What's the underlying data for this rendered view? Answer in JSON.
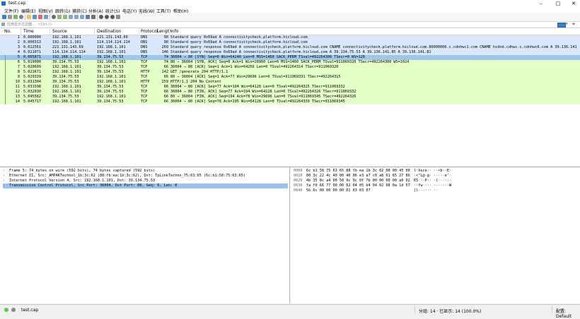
{
  "window": {
    "title": "test.cap"
  },
  "menu": [
    "文件(F)",
    "编辑(E)",
    "视图(V)",
    "跳转(G)",
    "捕获(C)",
    "分析(A)",
    "统计(S)",
    "电话(Y)",
    "无线(W)",
    "工具(T)",
    "帮助(H)"
  ],
  "filter": {
    "placeholder": "应用显示过滤器 … <Ctrl-/>"
  },
  "columns": [
    "No.",
    "Time",
    "Source",
    "Destination",
    "Protocol",
    "Length",
    "Info"
  ],
  "packets": [
    {
      "no": "1",
      "time": "0.000000",
      "src": "192.168.1.101",
      "dst": "221.131.143.69",
      "proto": "DNS",
      "len": "90",
      "info": "Standard query 0x69ad A connectivitycheck.platform.hicloud.com",
      "bg": "#dae8fc",
      "mark": false
    },
    {
      "no": "2",
      "time": "0.000313",
      "src": "192.168.1.101",
      "dst": "114.114.114.114",
      "proto": "DNS",
      "len": "90",
      "info": "Standard query 0x69ad A connectivitycheck.platform.hicloud.com",
      "bg": "#dae8fc",
      "mark": false
    },
    {
      "no": "3",
      "time": "0.012561",
      "src": "221.131.143.69",
      "dst": "192.168.1.101",
      "proto": "DNS",
      "len": "269",
      "info": "Standard query response 0x69ad A connectivitycheck.platform.hicloud.com CNAME connectivitycheck.platform.hicloud.com.80000000.c.cdnhwc1.com CNAME hcdnd.cdhwc.c.cdnhwc6.com A 39.136.141.85 A 39.136.75.53",
      "bg": "#dae8fc",
      "mark": false
    },
    {
      "no": "4",
      "time": "0.021071",
      "src": "114.114.114.114",
      "dst": "192.168.1.101",
      "proto": "DNS",
      "len": "146",
      "info": "Standard query response 0x69ad A connectivitycheck.platform.hicloud.com A 39.134.75.53 A 39.136.141.85 A 39.136.141.81",
      "bg": "#dae8fc",
      "mark": false
    },
    {
      "no": "5",
      "time": "0.005871",
      "src": "192.168.1.101",
      "dst": "39.134.75.53",
      "proto": "TCP",
      "len": "74",
      "info": "36004 → 80 [SYN] Seq=0 Win=64240 Len=0 MSS=1460 SACK_PERM TSval=492264300 TSecr=0 WS=128",
      "bg": "#9fc7ee",
      "mark": true
    },
    {
      "no": "6",
      "time": "5.019000",
      "src": "39.134.75.53",
      "dst": "192.168.1.101",
      "proto": "TCP",
      "len": "74",
      "info": "80 → 36004 [SYN, ACK] Seq=0 Ack=1 Win=28960 Len=0 MSS=1460 SACK_PERM TSval=911069320 TSecr=492264300 WS=1024",
      "bg": "#e4ffc7",
      "mark": true
    },
    {
      "no": "7",
      "time": "5.020609",
      "src": "192.168.1.101",
      "dst": "39.134.75.53",
      "proto": "TCP",
      "len": "66",
      "info": "36004 → 80 [ACK] Seq=1 Ack=1 Win=64256 Len=0 TSval=492264314 TSecr=911069320",
      "bg": "#e4ffc7",
      "mark": true
    },
    {
      "no": "8",
      "time": "5.021671",
      "src": "192.168.1.101",
      "dst": "39.134.75.53",
      "proto": "HTTP",
      "len": "142",
      "info": "GET /generate_204 HTTP/1.1",
      "bg": "#e4ffc7",
      "mark": true
    },
    {
      "no": "9",
      "time": "5.029339",
      "src": "39.134.75.53",
      "dst": "192.168.1.101",
      "proto": "TCP",
      "len": "66",
      "info": "80 → 36004 [ACK] Seq=1 Ack=77 Win=29696 Len=0 TSval=911069331 TSecr=492264315",
      "bg": "#e4ffc7",
      "mark": true
    },
    {
      "no": "10",
      "time": "5.031304",
      "src": "39.134.75.53",
      "dst": "192.168.1.101",
      "proto": "HTTP",
      "len": "259",
      "info": "HTTP/1.1 204 No Content",
      "bg": "#e4ffc7",
      "mark": true
    },
    {
      "no": "11",
      "time": "5.031598",
      "src": "192.168.1.101",
      "dst": "39.134.75.53",
      "proto": "TCP",
      "len": "66",
      "info": "36004 → 80 [ACK] Seq=77 Ack=194 Win=64128 Len=0 TSval=492264325 TSecr=911069332",
      "bg": "#e4ffc7",
      "mark": true
    },
    {
      "no": "12",
      "time": "5.032030",
      "src": "192.168.1.101",
      "dst": "39.134.75.53",
      "proto": "TCP",
      "len": "66",
      "info": "36004 → 80 [FIN, ACK] Seq=77 Ack=194 Win=64128 Len=0 TSval=492264326 TSecr=911069332",
      "bg": "#e4ffc7",
      "mark": true
    },
    {
      "no": "13",
      "time": "5.045582",
      "src": "39.134.75.53",
      "dst": "192.168.1.101",
      "proto": "TCP",
      "len": "66",
      "info": "80 → 36004 [FIN, ACK] Seq=194 Ack=78 Win=29696 Len=0 TSval=911069345 TSecr=492264326",
      "bg": "#e4ffc7",
      "mark": true
    },
    {
      "no": "14",
      "time": "5.045717",
      "src": "192.168.1.101",
      "dst": "39.134.75.53",
      "proto": "TCP",
      "len": "66",
      "info": "36004 → 80 [ACK] Seq=78 Ack=195 Win=64128 Len=0 TSval=492264339 TSecr=911069345",
      "bg": "#e4ffc7",
      "mark": true
    }
  ],
  "details": [
    {
      "text": "Frame 5: 74 bytes on wire (592 bits), 74 bytes captured (592 bits)",
      "selected": false
    },
    {
      "text": "Ethernet II, Src: AMPAKTechnol_1b:3c:62 (88:fb:ea:1b:3c:62), Dst: TpLinkTechno_75:63:65 (6c:b1:58:75:63:65)",
      "selected": false
    },
    {
      "text": "Internet Protocol Version 4, Src: 192.168.1.101, Dst: 39.134.75.53",
      "selected": false
    },
    {
      "text": "Transmission Control Protocol, Src Port: 36004, Dst Port: 80, Seq: 0, Len: 0",
      "selected": true
    }
  ],
  "hex": [
    {
      "off": "0000",
      "bytes": "6c b1 58 75 63 65 88 fb  ea 1b 3c 62 08 00 45 00",
      "ascii": "l·Xuce·· ··<b··E·"
    },
    {
      "off": "0010",
      "bytes": "00 3c 22 4c 40 00 40 06  e3 a7 c0 a8 01 65 27 86",
      "ascii": "·<\"L@·@· ·····e'·"
    },
    {
      "off": "0020",
      "bytes": "4b 35 8c a4 00 50 9c 9c  0f 7b 00 00 00 00 a0 02",
      "ascii": "K5···P·· ·{······"
    },
    {
      "off": "0030",
      "bytes": "fa f0 66 77 00 00 02 04  05 b4 04 02 08 0a 1d 57",
      "ascii": "··fw···· ·······W"
    },
    {
      "off": "0040",
      "bytes": "5b 6c 00 00 00 00 01 03  03 07",
      "ascii": "[l······ ··"
    }
  ],
  "status": {
    "file": "test.cap",
    "stats": "分组: 14 · 已显示: 14 (100.0%)",
    "profile": "配置: Default"
  },
  "colors": {
    "dns_row": "#dae8fc",
    "tcp_row": "#e4ffc7",
    "selected_row": "#9fc7ee",
    "detail_selected": "#99c2ee",
    "accent": "#3b7fc4"
  }
}
